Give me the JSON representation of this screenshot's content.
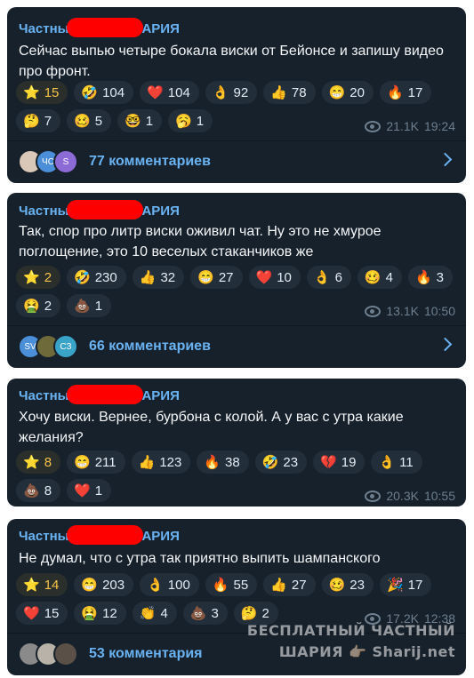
{
  "posts": [
    {
      "sender_prefix": "Частны",
      "sender_suffix": "АРИЯ",
      "text": "Сейчас выпью четыре бокала виски от Бейонсе и запишу видео про фронт.",
      "reaction_rows": [
        [
          {
            "emoji": "⭐",
            "count": "15",
            "paid": true
          },
          {
            "emoji": "🤣",
            "count": "104"
          },
          {
            "emoji": "❤️",
            "count": "104"
          },
          {
            "emoji": "👌",
            "count": "92"
          },
          {
            "emoji": "👍",
            "count": "78"
          },
          {
            "emoji": "😁",
            "count": "20"
          },
          {
            "emoji": "🔥",
            "count": "17"
          }
        ],
        [
          {
            "emoji": "🤔",
            "count": "7"
          },
          {
            "emoji": "🥴",
            "count": "5"
          },
          {
            "emoji": "🤓",
            "count": "1"
          },
          {
            "emoji": "🥱",
            "count": "1"
          }
        ]
      ],
      "views": "21.1K",
      "time": "19:24",
      "comments": {
        "label": "77 комментариев",
        "avatars": [
          {
            "text": "",
            "color": "#d9c7b8",
            "icon": "user-photo"
          },
          {
            "text": "ЧС",
            "color": "#4a8fd8"
          },
          {
            "text": "S",
            "color": "#8d6bd6"
          }
        ]
      }
    },
    {
      "sender_prefix": "Частны",
      "sender_suffix": "АРИЯ",
      "text": "Так, спор про литр виски оживил чат. Ну это не хмурое поглощение, это 10 веселых стаканчиков же",
      "reaction_rows": [
        [
          {
            "emoji": "⭐",
            "count": "2",
            "paid": true
          },
          {
            "emoji": "🤣",
            "count": "230"
          },
          {
            "emoji": "👍",
            "count": "32"
          },
          {
            "emoji": "😁",
            "count": "27"
          },
          {
            "emoji": "❤️",
            "count": "10"
          },
          {
            "emoji": "👌",
            "count": "6"
          },
          {
            "emoji": "🥴",
            "count": "4"
          },
          {
            "emoji": "🔥",
            "count": "3"
          }
        ],
        [
          {
            "emoji": "🤮",
            "count": "2"
          },
          {
            "emoji": "💩",
            "count": "1"
          }
        ]
      ],
      "views": "13.1K",
      "time": "10:50",
      "comments": {
        "label": "66 комментариев",
        "avatars": [
          {
            "text": "SV",
            "color": "#4a8fd8"
          },
          {
            "text": "",
            "color": "#6f6a3a",
            "icon": "group-photo"
          },
          {
            "text": "СЗ",
            "color": "#3aa3c8"
          }
        ]
      }
    },
    {
      "sender_prefix": "Частны",
      "sender_suffix": "АРИЯ",
      "text": "Хочу виски. Вернее, бурбона с колой. А у вас с утра какие желания?",
      "reaction_rows": [
        [
          {
            "emoji": "⭐",
            "count": "8",
            "paid": true
          },
          {
            "emoji": "😁",
            "count": "211"
          },
          {
            "emoji": "👍",
            "count": "123"
          },
          {
            "emoji": "🔥",
            "count": "38"
          },
          {
            "emoji": "🤣",
            "count": "23"
          },
          {
            "emoji": "💔",
            "count": "19"
          },
          {
            "emoji": "👌",
            "count": "11"
          }
        ],
        [
          {
            "emoji": "💩",
            "count": "8"
          },
          {
            "emoji": "❤️",
            "count": "1"
          }
        ]
      ],
      "views": "20.3K",
      "time": "10:55"
    },
    {
      "sender_prefix": "Частны",
      "sender_suffix": "АРИЯ",
      "text": "Не думал, что с утра так приятно выпить шампанского",
      "reaction_rows": [
        [
          {
            "emoji": "⭐",
            "count": "14",
            "paid": true
          },
          {
            "emoji": "😁",
            "count": "203"
          },
          {
            "emoji": "👌",
            "count": "100"
          },
          {
            "emoji": "🔥",
            "count": "55"
          },
          {
            "emoji": "👍",
            "count": "27"
          },
          {
            "emoji": "🥴",
            "count": "23"
          },
          {
            "emoji": "🎉",
            "count": "17"
          }
        ],
        [
          {
            "emoji": "❤️",
            "count": "15"
          },
          {
            "emoji": "🤮",
            "count": "12"
          },
          {
            "emoji": "👏",
            "count": "4"
          },
          {
            "emoji": "💩",
            "count": "3"
          },
          {
            "emoji": "🤔",
            "count": "2"
          }
        ]
      ],
      "views": "17.2K",
      "time": "12:38",
      "comments": {
        "label": "53 комментария",
        "avatars": [
          {
            "text": "",
            "color": "#8a8a8a",
            "icon": "user-photo"
          },
          {
            "text": "",
            "color": "#b8b2a8",
            "icon": "user-photo"
          },
          {
            "text": "",
            "color": "#5a5048",
            "icon": "user-photo"
          }
        ]
      }
    }
  ],
  "watermark": {
    "line1": "БЕСПЛАТНЫЙ ЧАСТНЫЙ",
    "line2": "ШАРИЯ 👉🏻 Sharij.net"
  },
  "colors": {
    "card_bg": "#17212b",
    "accent": "#6ab3f3",
    "redaction": "#fe0000",
    "paid_star": "#f6c24a"
  }
}
